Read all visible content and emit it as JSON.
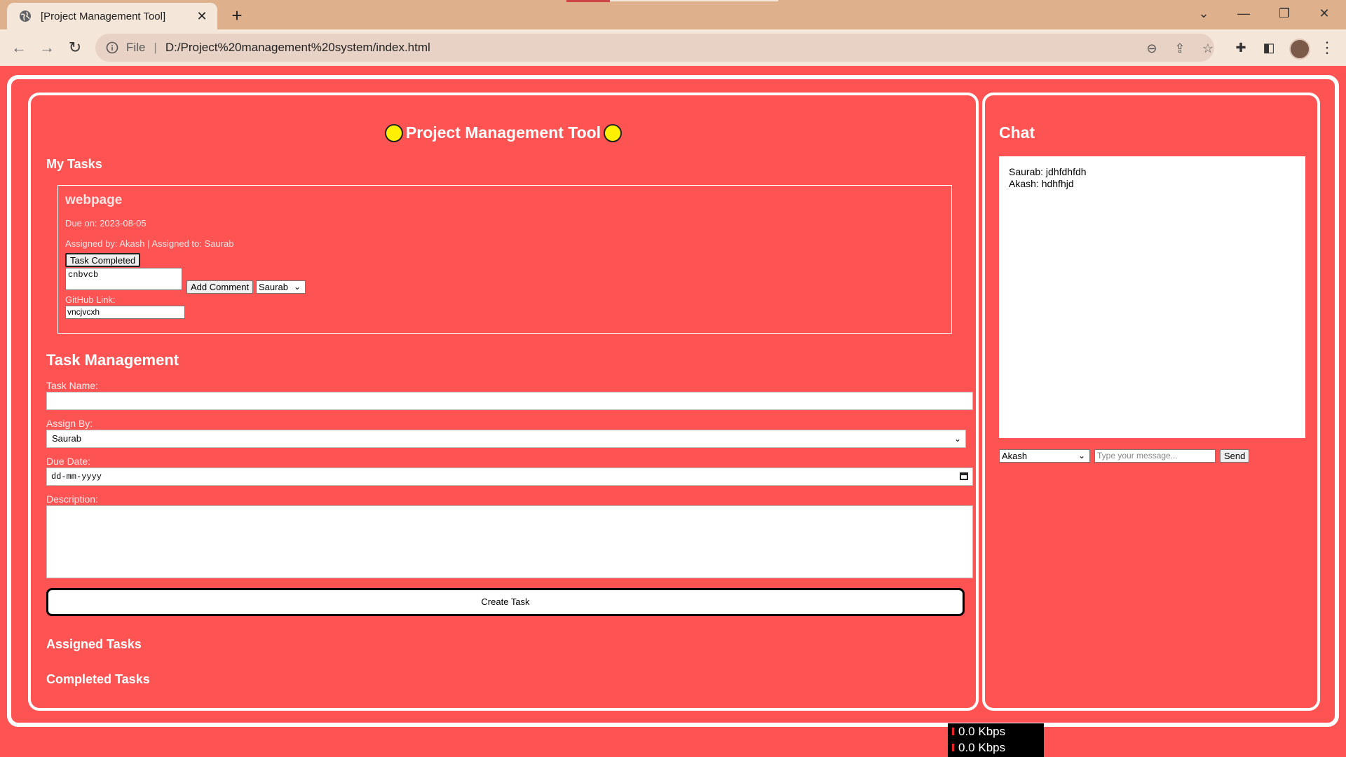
{
  "browser": {
    "tab_title": "[Project Management Tool]",
    "omnibox_scheme": "File",
    "url": "D:/Project%20management%20system/index.html"
  },
  "app": {
    "title": "Project Management Tool",
    "my_tasks_heading": "My Tasks",
    "task_card": {
      "name": "webpage",
      "due": "Due on: 2023-08-05",
      "assigned": "Assigned by: Akash | Assigned to: Saurab",
      "complete_button": "Task Completed",
      "comment_value": "cnbvcb",
      "add_comment_button": "Add Comment",
      "comment_user": "Saurab",
      "github_label": "GitHub Link:",
      "github_value": "vncjvcxh"
    },
    "task_management": {
      "heading": "Task Management",
      "task_name_label": "Task Name:",
      "task_name_value": "",
      "assign_by_label": "Assign By:",
      "assign_by_value": "Saurab",
      "due_date_label": "Due Date:",
      "due_date_placeholder": "dd-mm-yyyy",
      "description_label": "Description:",
      "description_value": "",
      "create_button": "Create Task"
    },
    "assigned_heading": "Assigned Tasks",
    "completed_heading": "Completed Tasks"
  },
  "chat": {
    "heading": "Chat",
    "messages": [
      "Saurab: jdhfdhfdh",
      "Akash: hdhfhjd"
    ],
    "sender": "Akash",
    "input_placeholder": "Type your message...",
    "send_button": "Send"
  },
  "netspeed": {
    "up": "0.0 Kbps",
    "down": "0.0 Kbps"
  }
}
